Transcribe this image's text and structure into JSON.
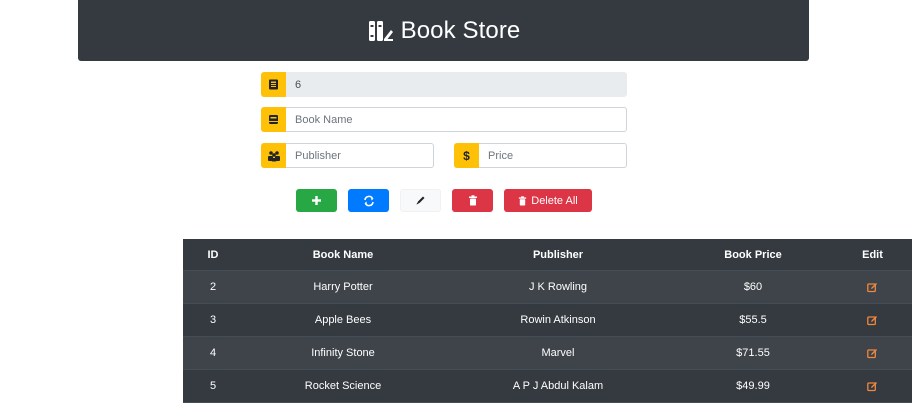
{
  "header": {
    "title": "Book Store"
  },
  "form": {
    "id_value": "6",
    "book_name_placeholder": "Book Name",
    "publisher_placeholder": "Publisher",
    "price_placeholder": "Price"
  },
  "buttons": {
    "delete_all_label": "Delete All"
  },
  "table": {
    "headers": {
      "id": "ID",
      "name": "Book Name",
      "publisher": "Publisher",
      "price": "Book Price",
      "edit": "Edit"
    },
    "rows": [
      {
        "id": "2",
        "name": "Harry Potter",
        "publisher": "J K Rowling",
        "price": "$60"
      },
      {
        "id": "3",
        "name": "Apple Bees",
        "publisher": "Rowin Atkinson",
        "price": "$55.5"
      },
      {
        "id": "4",
        "name": "Infinity Stone",
        "publisher": "Marvel",
        "price": "$71.55"
      },
      {
        "id": "5",
        "name": "Rocket Science",
        "publisher": "A P J Abdul Kalam",
        "price": "$49.99"
      }
    ]
  },
  "colors": {
    "header_bg": "#343a40",
    "addon_yellow": "#ffc107",
    "add_green": "#28a745",
    "refresh_blue": "#007bff",
    "delete_red": "#dc3545",
    "edit_icon_orange": "#f0883e"
  },
  "icons": {
    "logo": "books-icon",
    "id_addon": "id-card-icon",
    "name_addon": "book-icon",
    "publisher_addon": "people-icon",
    "price_addon": "dollar-icon",
    "add": "plus-icon",
    "refresh": "sync-icon",
    "update": "pencil-icon",
    "delete": "trash-icon",
    "edit": "edit-icon"
  }
}
